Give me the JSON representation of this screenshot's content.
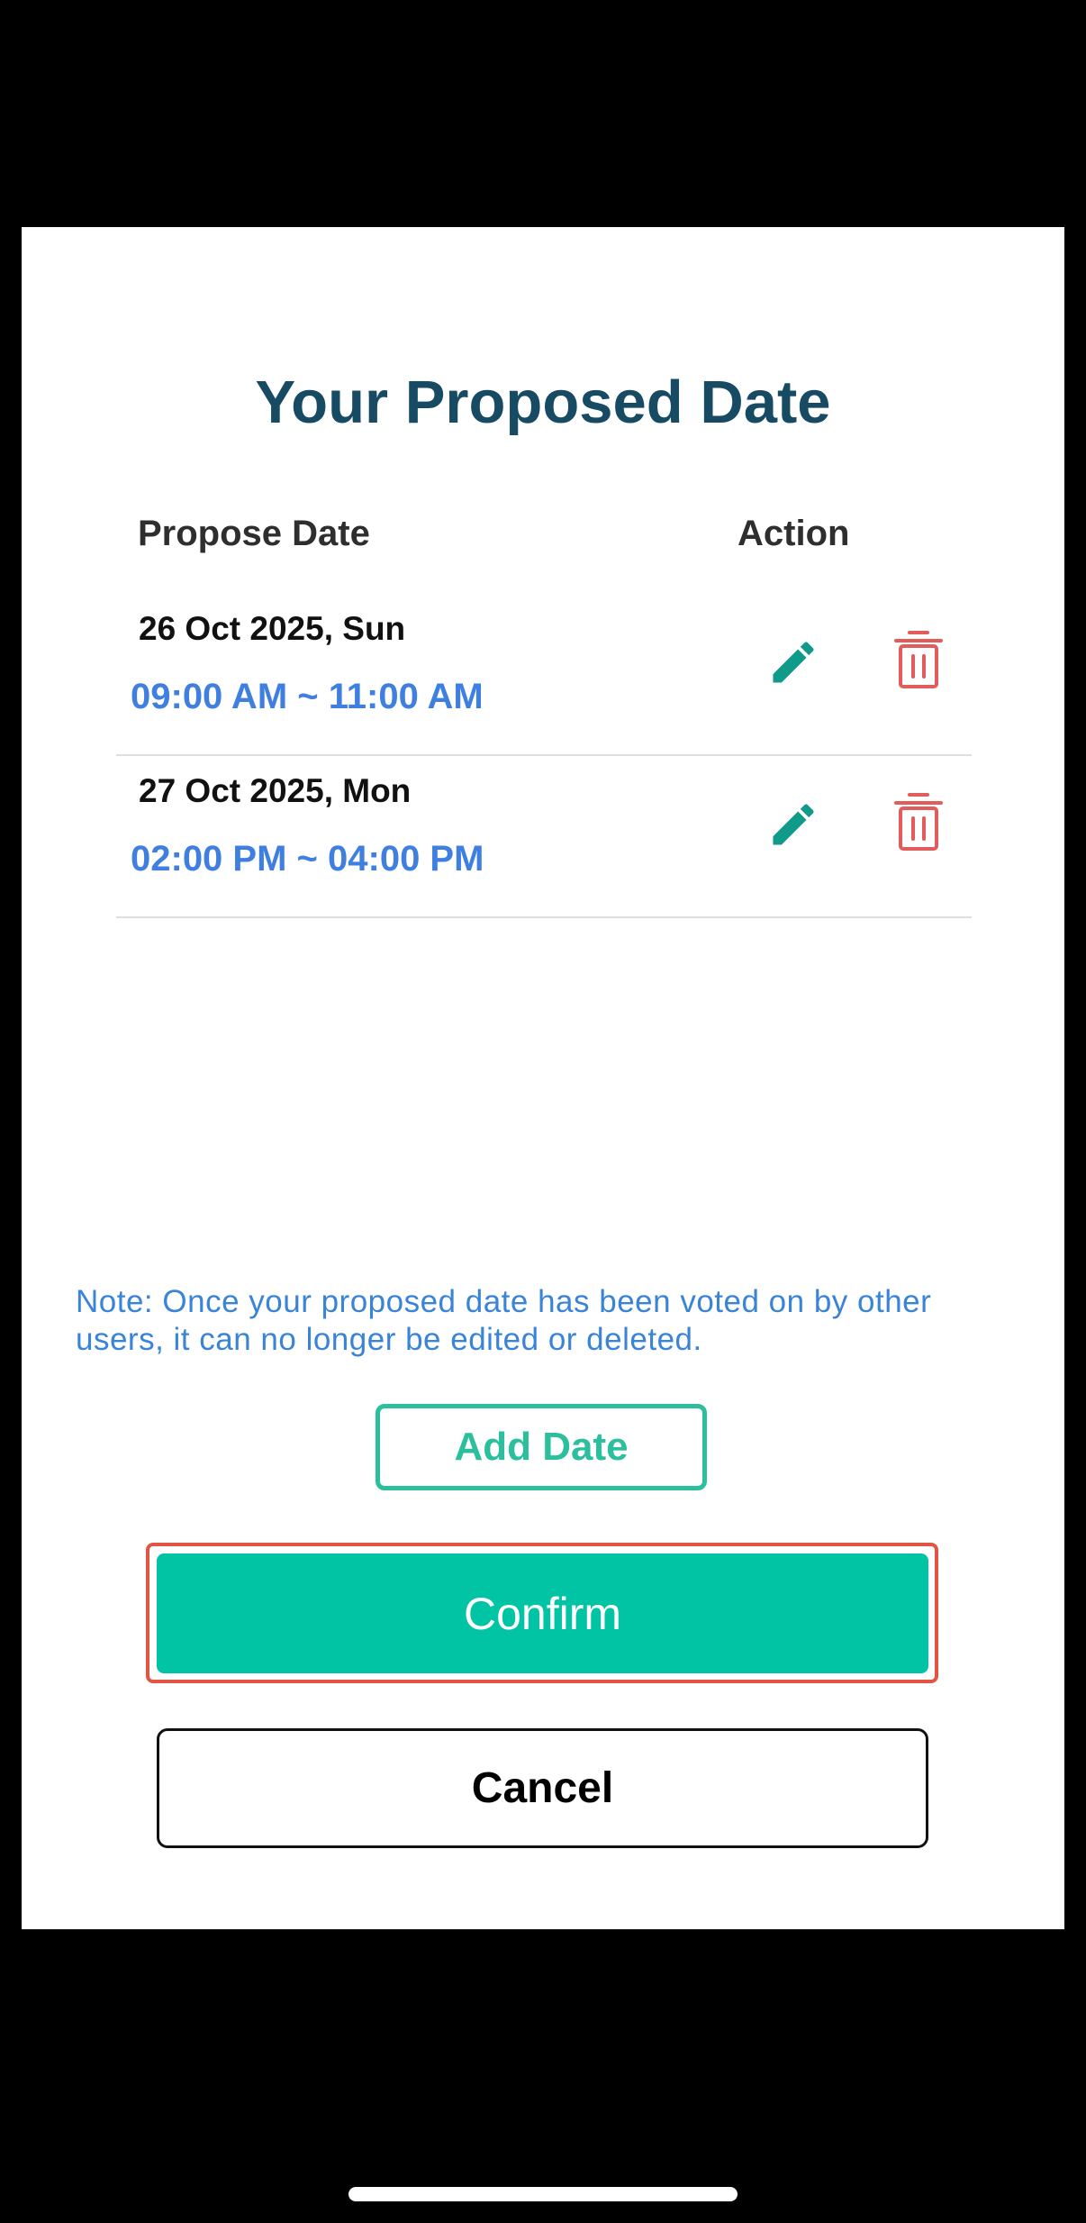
{
  "modal": {
    "title": "Your Proposed Date",
    "columns": {
      "date": "Propose Date",
      "action": "Action"
    },
    "proposals": [
      {
        "date": "26 Oct 2025, Sun",
        "time": "09:00 AM ~ 11:00 AM",
        "edit_icon": "pencil-icon",
        "delete_icon": "trash-icon"
      },
      {
        "date": "27 Oct 2025, Mon",
        "time": "02:00 PM ~ 04:00 PM",
        "edit_icon": "pencil-icon",
        "delete_icon": "trash-icon"
      }
    ],
    "note": "Note: Once your proposed date has been voted on by other users, it can no longer be edited or deleted.",
    "add_date_label": "Add Date",
    "confirm_label": "Confirm",
    "cancel_label": "Cancel"
  },
  "colors": {
    "title": "#174b63",
    "time": "#3f7fe0",
    "edit_icon": "#0f9a8a",
    "delete_icon": "#e25c5c",
    "accent": "#00c4a3",
    "highlight_outline": "#e25545"
  }
}
